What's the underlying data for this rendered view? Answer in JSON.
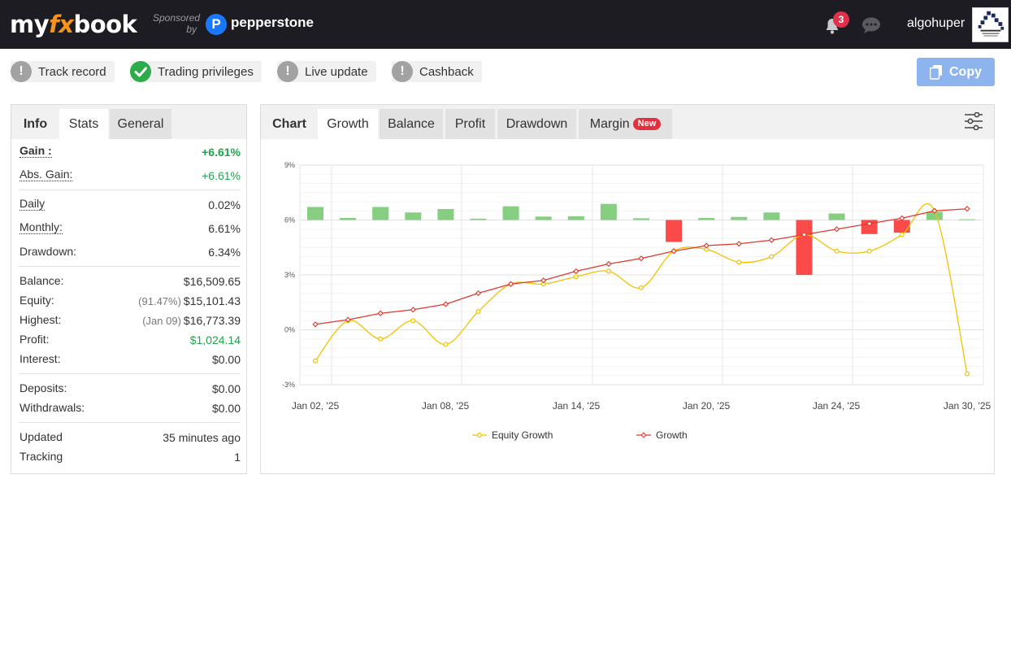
{
  "header": {
    "logo": {
      "pre": "my",
      "fx": "fx",
      "post": "book"
    },
    "sponsored_line1": "Sponsored",
    "sponsored_line2": "by",
    "sponsor_name": "pepperstone",
    "sponsor_icon": "P",
    "notification_count": "3",
    "username": "algohuper"
  },
  "status": {
    "items": [
      {
        "label": "Track record",
        "icon": "exclamation-icon"
      },
      {
        "label": "Trading privileges",
        "icon": "check-icon"
      },
      {
        "label": "Live update",
        "icon": "exclamation-icon"
      },
      {
        "label": "Cashback",
        "icon": "exclamation-icon"
      }
    ],
    "copy_label": "Copy"
  },
  "left_tabs": [
    "Info",
    "Stats",
    "General"
  ],
  "stats": {
    "gain_label": "Gain :",
    "gain_value": "+6.61%",
    "abs_gain_label": "Abs. Gain:",
    "abs_gain_value": "+6.61%",
    "daily_label": "Daily",
    "daily_value": "0.02%",
    "monthly_label": "Monthly:",
    "monthly_value": "6.61%",
    "drawdown_label": "Drawdown:",
    "drawdown_value": "6.34%",
    "balance_label": "Balance:",
    "balance_value": "$16,509.65",
    "equity_label": "Equity:",
    "equity_note": "(91.47%)",
    "equity_value": "$15,101.43",
    "highest_label": "Highest:",
    "highest_note": "(Jan 09)",
    "highest_value": "$16,773.39",
    "profit_label": "Profit:",
    "profit_value": "$1,024.14",
    "interest_label": "Interest:",
    "interest_value": "$0.00",
    "deposits_label": "Deposits:",
    "deposits_value": "$0.00",
    "withdrawals_label": "Withdrawals:",
    "withdrawals_value": "$0.00",
    "updated_label": "Updated",
    "updated_value": "35 minutes ago",
    "tracking_label": "Tracking",
    "tracking_value": "1"
  },
  "chart_tabs": {
    "title": "Chart",
    "tabs": [
      "Growth",
      "Balance",
      "Profit",
      "Drawdown",
      "Margin"
    ],
    "new_badge": "New"
  },
  "colors": {
    "positive_bar": "#86cf80",
    "negative_bar": "#fb4a4a",
    "growth_line": "#e03a2e",
    "equity_line": "#f2c200",
    "positive_text": "#1ea64a"
  },
  "chart_data": {
    "type": "line",
    "x_ticks": [
      "Jan 02, '25",
      "Jan 08, '25",
      "Jan 14, '25",
      "Jan 20, '25",
      "Jan 24, '25",
      "Jan 30, '25"
    ],
    "y_ticks": [
      "9%",
      "6%",
      "3%",
      "0%",
      "-3%"
    ],
    "ylim": [
      -3,
      9
    ],
    "legend_position": "bottom",
    "series": [
      {
        "name": "Equity Growth",
        "values": [
          -1.7,
          0.5,
          -0.5,
          0.5,
          -0.8,
          1.0,
          2.5,
          2.5,
          2.9,
          3.2,
          2.3,
          4.3,
          4.4,
          3.7,
          4.0,
          5.2,
          4.3,
          4.3,
          5.2,
          6.5,
          -2.4
        ]
      },
      {
        "name": "Growth",
        "values": [
          0.3,
          0.55,
          0.9,
          1.1,
          1.4,
          2.0,
          2.5,
          2.7,
          3.2,
          3.6,
          3.9,
          4.3,
          4.6,
          4.7,
          4.9,
          5.2,
          5.5,
          5.8,
          6.1,
          6.5,
          6.61
        ]
      }
    ],
    "daily_change": [
      1.9,
      0.3,
      1.9,
      1.1,
      1.6,
      0.2,
      2.0,
      0.5,
      0.55,
      2.35,
      0.25,
      -3.2,
      0.3,
      0.45,
      1.1,
      -8.0,
      0.95,
      -2.05,
      -1.85,
      1.2,
      0.1
    ]
  }
}
